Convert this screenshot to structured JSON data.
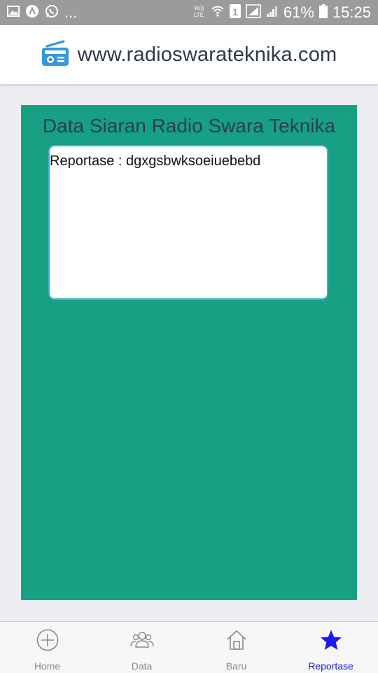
{
  "status_bar": {
    "network_label": "Vo)) LTE",
    "sim_label": "1",
    "battery": "61%",
    "time": "15:25",
    "left_icons": [
      "gallery-icon",
      "app-icon",
      "whatsapp-icon"
    ],
    "more_label": "..."
  },
  "header": {
    "title": "www.radioswarateknika.com",
    "icon": "radio-icon"
  },
  "main": {
    "title": "Data Siaran Radio Swara Teknika",
    "report_text": "Reportase : dgxgsbwksoeiuebebd"
  },
  "nav": {
    "items": [
      {
        "label": "Home",
        "icon": "plus-circle-icon"
      },
      {
        "label": "Data",
        "icon": "users-icon"
      },
      {
        "label": "Baru",
        "icon": "home-icon"
      },
      {
        "label": "Reportase",
        "icon": "star-icon"
      }
    ],
    "active_index": 3
  },
  "colors": {
    "card_bg": "#17a083",
    "active_nav": "#1a1aee",
    "header_icon": "#3498db"
  }
}
